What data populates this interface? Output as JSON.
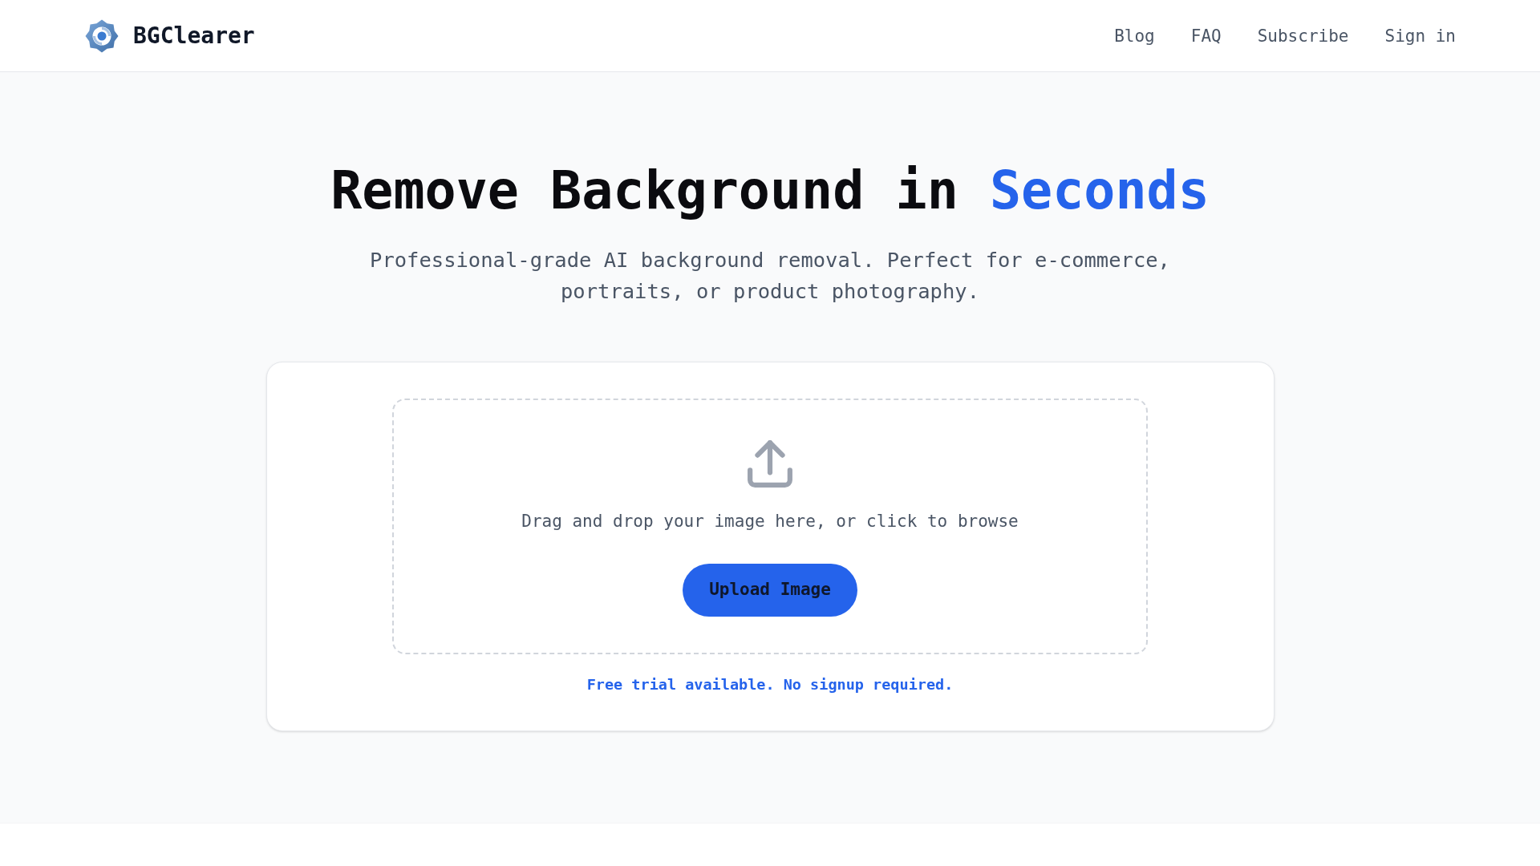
{
  "header": {
    "brand": "BGClearer",
    "nav": [
      "Blog",
      "FAQ",
      "Subscribe",
      "Sign in"
    ]
  },
  "hero": {
    "title": [
      {
        "text": "Remove Background in",
        "highlight": false
      },
      {
        "text": "Seconds",
        "highlight": true
      }
    ],
    "subtitle": "Professional-grade AI background removal. Perfect for e-commerce, portraits, or product photography."
  },
  "upload": {
    "prompt": "Drag and drop your image here, or click to browse",
    "button": "Upload Image",
    "note": "Free trial available. No signup required."
  }
}
